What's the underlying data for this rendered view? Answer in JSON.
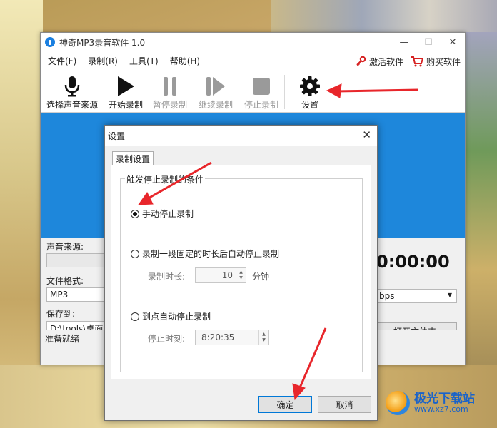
{
  "app": {
    "title": "神奇MP3录音软件 1.0",
    "menus": [
      "文件(F)",
      "录制(R)",
      "工具(T)",
      "帮助(H)"
    ],
    "activate_label": "激活软件",
    "buy_label": "购买软件"
  },
  "toolbar": {
    "select_source": "选择声音来源",
    "start": "开始录制",
    "pause": "暂停录制",
    "resume": "继续录制",
    "stop": "停止录制",
    "settings": "设置"
  },
  "main": {
    "source_label": "声音来源:",
    "format_label": "文件格式:",
    "format_value": "MP3",
    "save_label": "保存到:",
    "save_path": "D:\\tools\\桌面",
    "timer": "0:00:00",
    "bitrate_partial": "bps",
    "open_folder": "打开文件夹",
    "status": "准备就绪"
  },
  "dialog": {
    "title": "设置",
    "tab": "录制设置",
    "group_title": "触发停止录制的条件",
    "option_manual": "手动停止录制",
    "option_duration": "录制一段固定的时长后自动停止录制",
    "duration_label": "录制时长:",
    "duration_value": "10",
    "duration_unit": "分钟",
    "option_time": "到点自动停止录制",
    "stop_time_label": "停止时刻:",
    "stop_time_value": "8:20:35",
    "ok": "确定",
    "cancel": "取消",
    "selected_option": "manual"
  },
  "watermark": {
    "main": "极光下载站",
    "sub": "www.xz7.com"
  },
  "colors": {
    "accent_blue": "#1e87db",
    "annotation_red": "#e8262b"
  }
}
